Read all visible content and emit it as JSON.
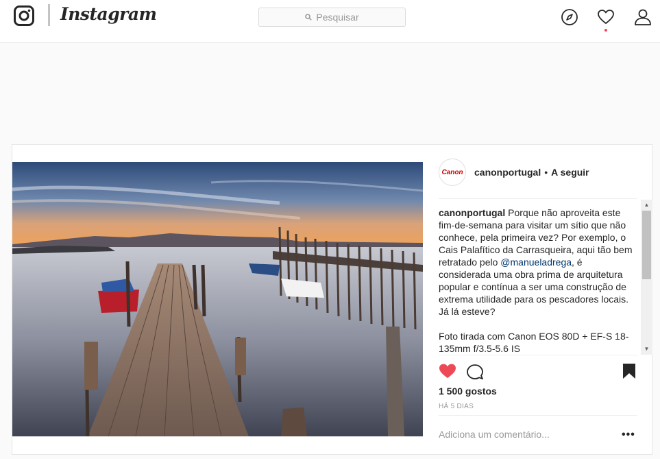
{
  "app": {
    "name": "Instagram"
  },
  "search": {
    "placeholder": "Pesquisar"
  },
  "nav": {
    "icons": [
      "compass-icon",
      "heart-icon",
      "person-icon"
    ],
    "notification_color": "#ed4956"
  },
  "post": {
    "username": "canonportugal",
    "avatar_text": "Canon",
    "separator": "•",
    "follow_label": "A seguir",
    "caption": {
      "username": "canonportugal",
      "part1": " Porque não aproveita este fim-de-semana para visitar um sítio que não conhece, pela primeira vez? Por exemplo, o Cais Palafítico da Carrasqueira, aqui tão bem retratado pelo ",
      "mention": "@manueladrega",
      "part2": ", é considerada uma obra prima de arquitetura popular e contínua a ser uma construção de extrema utilidade para os pescadores locais. Já lá esteve?",
      "part3": "Foto tirada com Canon EOS 80D + EF-S 18-135mm f/3.5-5.6 IS"
    },
    "likes": "1 500 gostos",
    "time": "HÁ 5 DIAS",
    "comment_placeholder": "Adiciona um comentário...",
    "more": "•••",
    "like_color": "#ed4956"
  }
}
